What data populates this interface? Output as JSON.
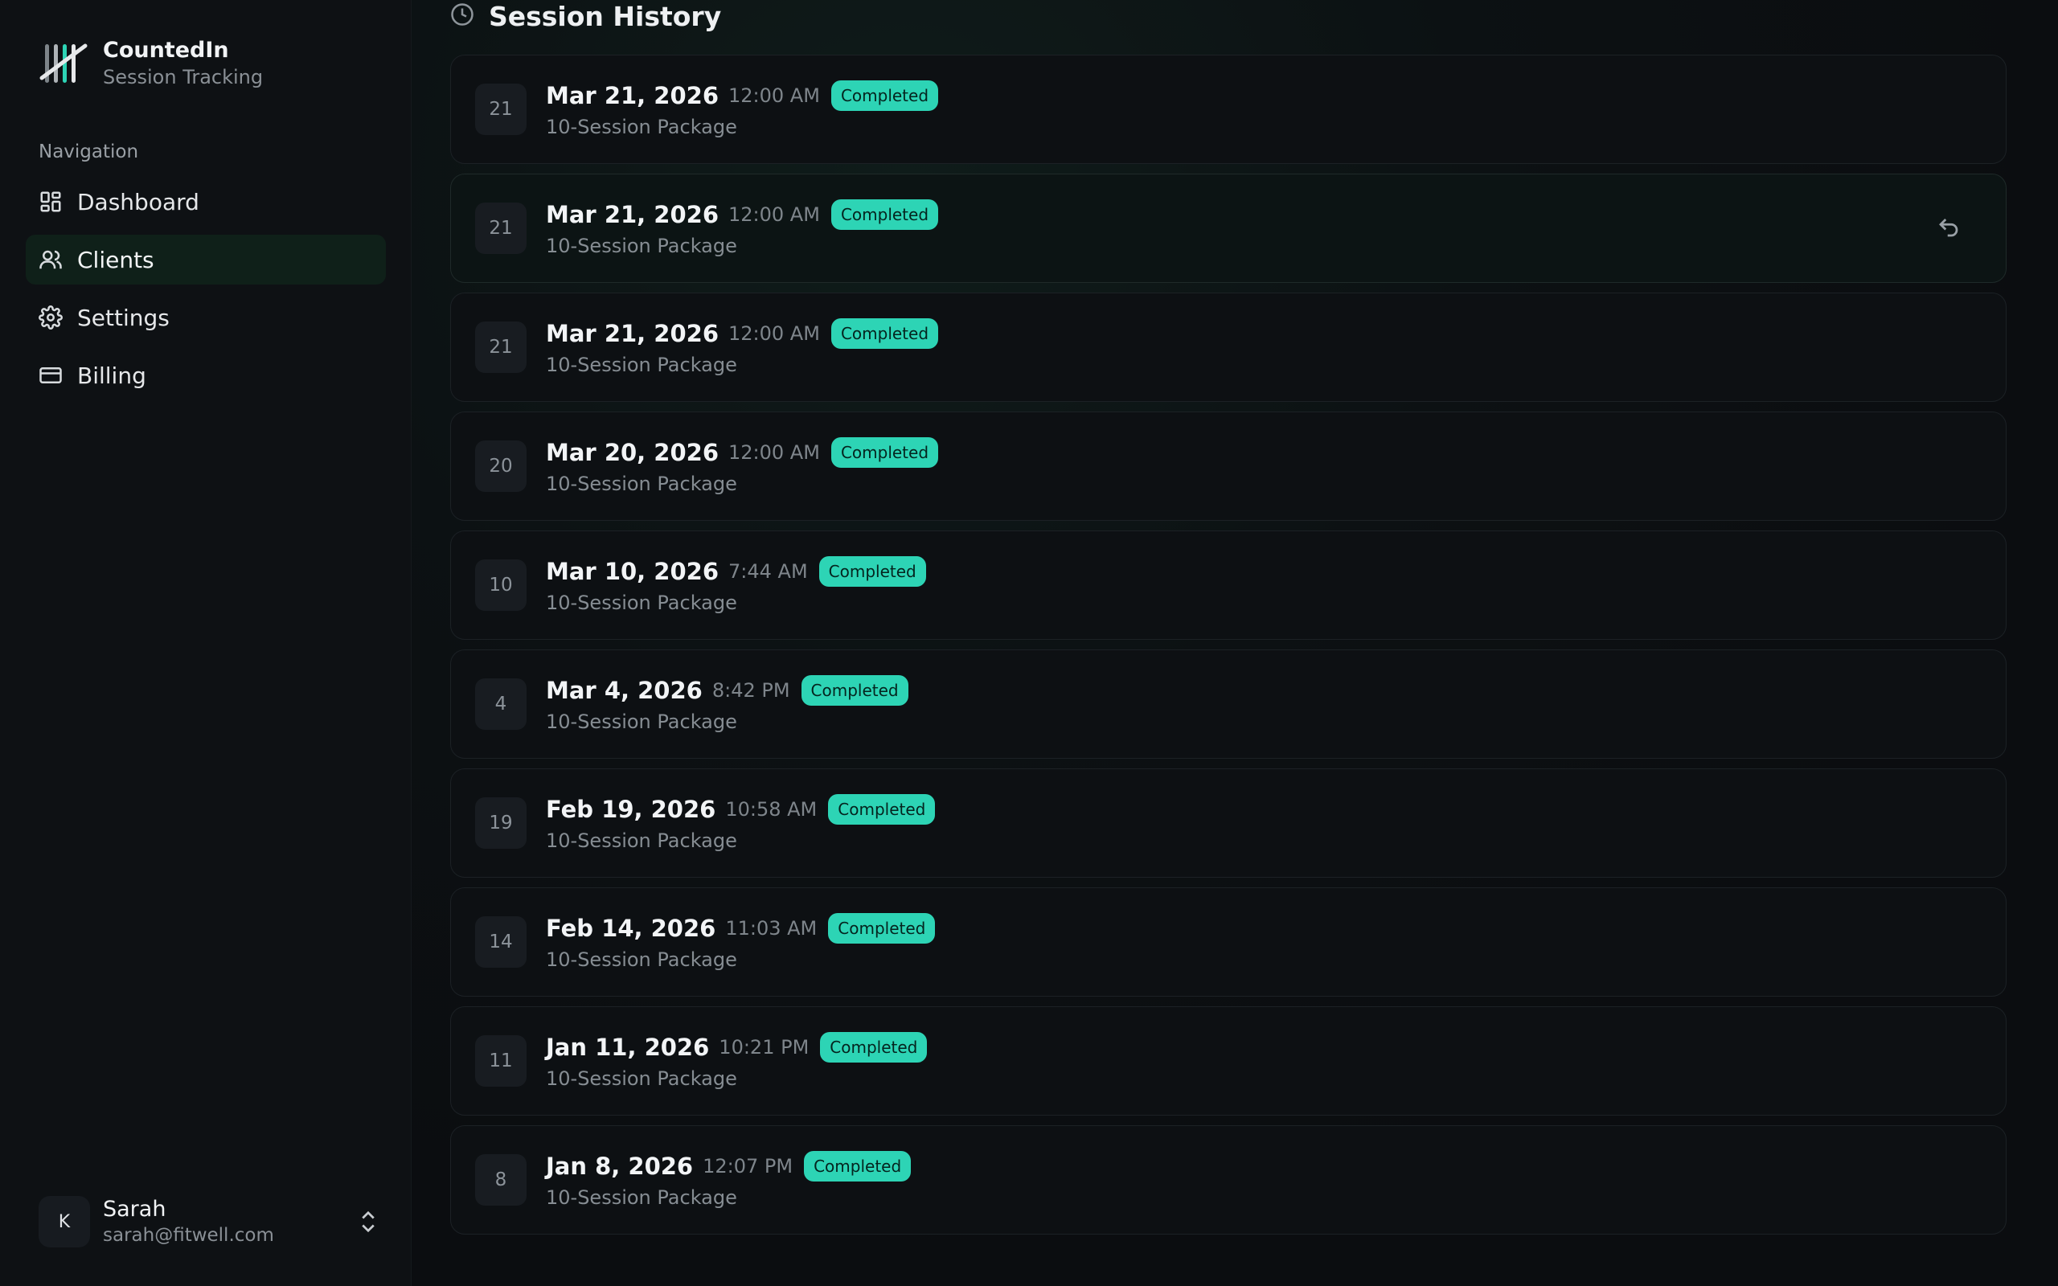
{
  "brand": {
    "name": "CountedIn",
    "subtitle": "Session Tracking"
  },
  "navigation": {
    "heading": "Navigation",
    "items": [
      {
        "label": "Dashboard",
        "icon": "dashboard-icon",
        "active": false
      },
      {
        "label": "Clients",
        "icon": "users-icon",
        "active": true
      },
      {
        "label": "Settings",
        "icon": "gear-icon",
        "active": false
      },
      {
        "label": "Billing",
        "icon": "credit-card-icon",
        "active": false
      }
    ]
  },
  "user": {
    "initial": "K",
    "name": "Sarah",
    "email": "sarah@fitwell.com"
  },
  "section": {
    "title": "Session History",
    "icon": "clock-icon"
  },
  "sessions": [
    {
      "day": "21",
      "date": "Mar 21, 2026",
      "time": "12:00 AM",
      "status": "Completed",
      "package": "10-Session Package"
    },
    {
      "day": "21",
      "date": "Mar 21, 2026",
      "time": "12:00 AM",
      "status": "Completed",
      "package": "10-Session Package",
      "hover": true
    },
    {
      "day": "21",
      "date": "Mar 21, 2026",
      "time": "12:00 AM",
      "status": "Completed",
      "package": "10-Session Package"
    },
    {
      "day": "20",
      "date": "Mar 20, 2026",
      "time": "12:00 AM",
      "status": "Completed",
      "package": "10-Session Package"
    },
    {
      "day": "10",
      "date": "Mar 10, 2026",
      "time": "7:44 AM",
      "status": "Completed",
      "package": "10-Session Package"
    },
    {
      "day": "4",
      "date": "Mar 4, 2026",
      "time": "8:42 PM",
      "status": "Completed",
      "package": "10-Session Package"
    },
    {
      "day": "19",
      "date": "Feb 19, 2026",
      "time": "10:58 AM",
      "status": "Completed",
      "package": "10-Session Package"
    },
    {
      "day": "14",
      "date": "Feb 14, 2026",
      "time": "11:03 AM",
      "status": "Completed",
      "package": "10-Session Package"
    },
    {
      "day": "11",
      "date": "Jan 11, 2026",
      "time": "10:21 PM",
      "status": "Completed",
      "package": "10-Session Package"
    },
    {
      "day": "8",
      "date": "Jan 8, 2026",
      "time": "12:07 PM",
      "status": "Completed",
      "package": "10-Session Package"
    }
  ],
  "colors": {
    "accent": "#2dd4b5",
    "background": "#0b0d10",
    "sidebar": "#0e1114",
    "active_nav": "#0f2019"
  }
}
